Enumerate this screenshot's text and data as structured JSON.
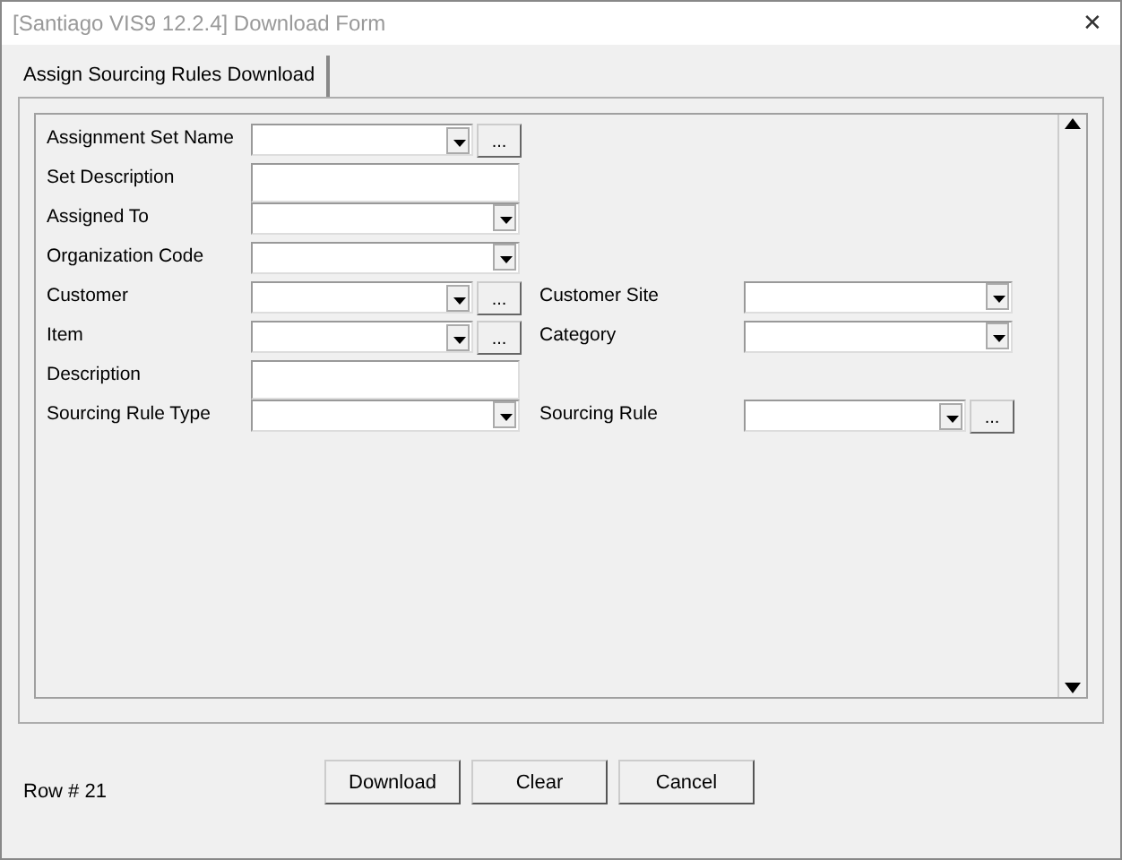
{
  "window": {
    "title": "[Santiago VIS9 12.2.4] Download Form",
    "close": "✕"
  },
  "tabs": [
    {
      "label": "Assign Sourcing Rules Download",
      "selected": true
    }
  ],
  "rows": [
    {
      "left": {
        "label": "Assignment Set Name",
        "kind": "combo_lookup",
        "lookup": "..."
      }
    },
    {
      "left": {
        "label": "Set Description",
        "kind": "text"
      }
    },
    {
      "left": {
        "label": "Assigned To",
        "kind": "combo"
      }
    },
    {
      "left": {
        "label": "Organization Code",
        "kind": "combo"
      }
    },
    {
      "left": {
        "label": "Customer",
        "kind": "combo_lookup",
        "lookup": "..."
      },
      "right": {
        "label": "Customer Site",
        "kind": "combo"
      }
    },
    {
      "left": {
        "label": "Item",
        "kind": "combo_lookup",
        "lookup": "..."
      },
      "right": {
        "label": "Category",
        "kind": "combo"
      }
    },
    {
      "left": {
        "label": "Description",
        "kind": "text"
      }
    },
    {
      "left": {
        "label": "Sourcing Rule Type",
        "kind": "combo"
      },
      "right": {
        "label": "Sourcing Rule",
        "kind": "combo_lookup",
        "lookup": "..."
      }
    }
  ],
  "status": "Row # 21",
  "buttons": [
    "Download",
    "Clear",
    "Cancel"
  ]
}
